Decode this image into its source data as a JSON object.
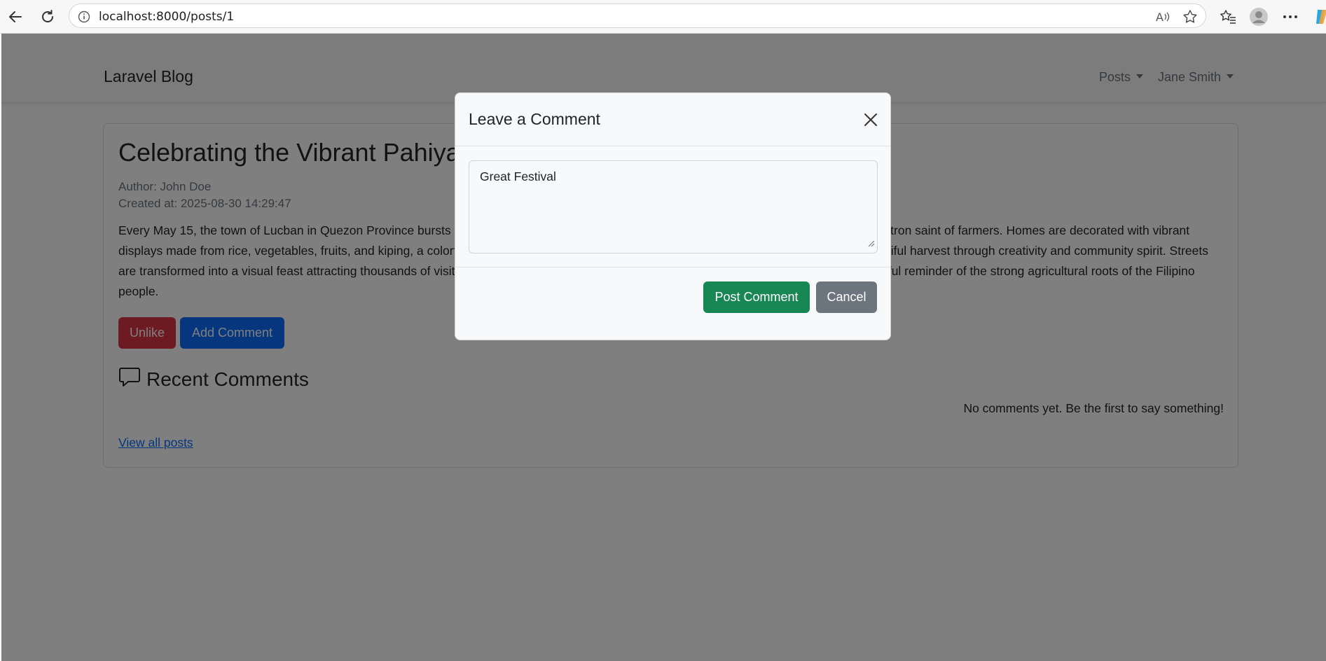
{
  "browser": {
    "url": "localhost:8000/posts/1"
  },
  "page": {
    "plus_mark": "+"
  },
  "navbar": {
    "brand": "Laravel Blog",
    "posts_menu": "Posts",
    "user_menu": "Jane Smith"
  },
  "post": {
    "title": "Celebrating the Vibrant Pahiyas Festival",
    "author": "Author: John Doe",
    "created_at": "Created at: 2025-08-30 14:29:47",
    "body": "Every May 15, the town of Lucban in Quezon Province bursts into color to celebrate the Pahiyas Festival, honoring San Isidro Labrador, the patron saint of farmers. Homes are decorated with vibrant displays made from rice, vegetables, fruits, and kiping, a colorful rice wafer. The festival is a way for the townspeople to give thanks for a bountiful harvest through creativity and community spirit. Streets are transformed into a visual feast attracting thousands of visitors every year. The Pahiyas Festival is not only a cultural treasure but also a joyful reminder of the strong agricultural roots of the Filipino people."
  },
  "actions": {
    "unlike_label": "Unlike",
    "add_comment_label": "Add Comment"
  },
  "comments": {
    "heading": "Recent Comments",
    "empty_text": "No comments yet. Be the first to say something!",
    "view_all_label": "View all posts"
  },
  "modal": {
    "title": "Leave a Comment",
    "comment_value": "Great Festival",
    "post_label": "Post Comment",
    "cancel_label": "Cancel"
  },
  "colors": {
    "danger": "#dc3545",
    "primary": "#0d6efd",
    "success": "#198754",
    "secondary": "#6c757d"
  }
}
